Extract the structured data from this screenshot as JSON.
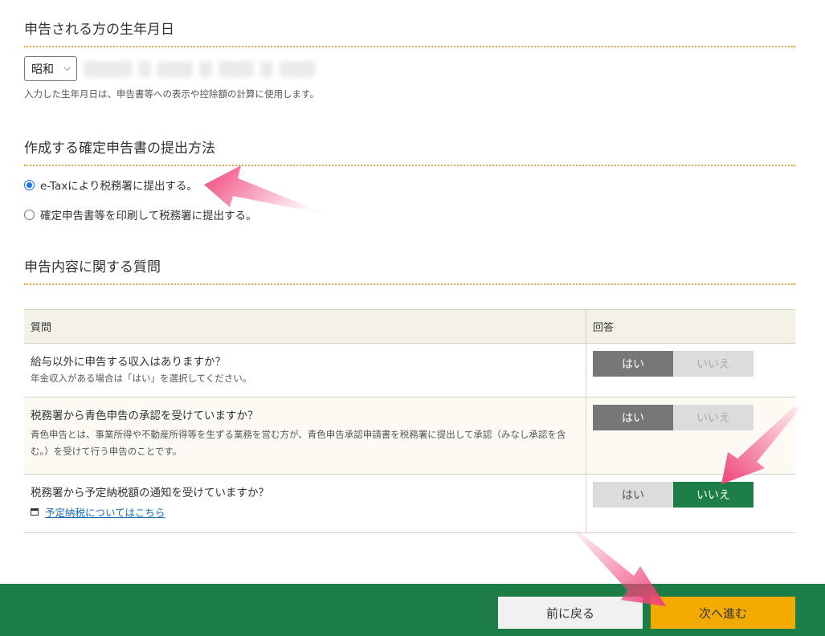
{
  "birth": {
    "title": "申告される方の生年月日",
    "era": "昭和",
    "hint": "入力した生年月日は、申告書等への表示や控除額の計算に使用します。"
  },
  "submission": {
    "title": "作成する確定申告書の提出方法",
    "options": [
      {
        "label": "e-Taxにより税務署に提出する。",
        "selected": true
      },
      {
        "label": "確定申告書等を印刷して税務署に提出する。",
        "selected": false
      }
    ]
  },
  "questions": {
    "title": "申告内容に関する質問",
    "col_question": "質問",
    "col_answer": "回答",
    "rows": [
      {
        "q": "給与以外に申告する収入はありますか？",
        "sub": "年金収入がある場合は「はい」を選択してください。",
        "yes": "はい",
        "no": "いいえ",
        "answer": "はい"
      },
      {
        "q": "税務署から青色申告の承認を受けていますか？",
        "sub": "青色申告とは、事業所得や不動産所得等を生ずる業務を営む方が、青色申告承認申請書を税務署に提出して承認（みなし承認を含む。）を受けて行う申告のことです。",
        "yes": "はい",
        "no": "いいえ",
        "answer": "はい"
      },
      {
        "q": "税務署から予定納税額の通知を受けていますか？",
        "link": "予定納税についてはこちら",
        "yes": "はい",
        "no": "いいえ",
        "answer": "いいえ"
      }
    ]
  },
  "footer": {
    "back": "前に戻る",
    "next": "次へ進む"
  },
  "colors": {
    "footer": "#1d7d46",
    "next_button": "#f3ab00",
    "selected_no": "#1e7e47",
    "arrow": "#f0457a"
  }
}
